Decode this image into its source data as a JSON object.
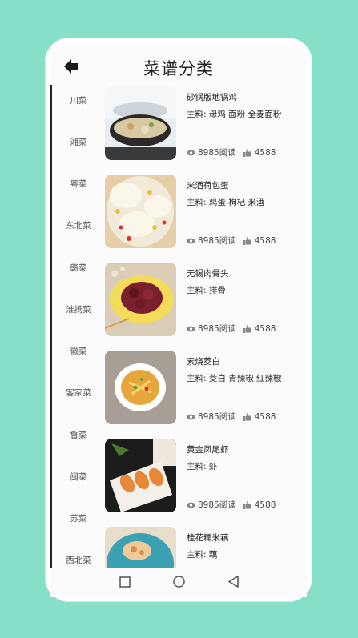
{
  "header": {
    "title": "菜谱分类"
  },
  "categories": [
    "川菜",
    "湘菜",
    "粤菜",
    "东北菜",
    "赣菜",
    "淮扬菜",
    "徽菜",
    "客家菜",
    "鲁菜",
    "闽菜",
    "苏菜",
    "西北菜"
  ],
  "recipes": [
    {
      "name": "砂锅版地锅鸡",
      "ingredients": "主料:  母鸡 面粉 全麦面粉",
      "reads": "8985阅读",
      "likes": "4588"
    },
    {
      "name": "米酒荷包蛋",
      "ingredients": "主料:  鸡蛋 枸杞 米酒",
      "reads": "8985阅读",
      "likes": "4588"
    },
    {
      "name": "无锡肉骨头",
      "ingredients": "主料:  排骨",
      "reads": "8985阅读",
      "likes": "4588"
    },
    {
      "name": "素烧茭白",
      "ingredients": "主料:  茭白 青辣椒 红辣椒",
      "reads": "8985阅读",
      "likes": "4588"
    },
    {
      "name": "黄金凤尾虾",
      "ingredients": "主料:  虾",
      "reads": "8985阅读",
      "likes": "4588"
    },
    {
      "name": "桂花糯米藕",
      "ingredients": "主料:  藕",
      "reads": "",
      "likes": ""
    }
  ]
}
